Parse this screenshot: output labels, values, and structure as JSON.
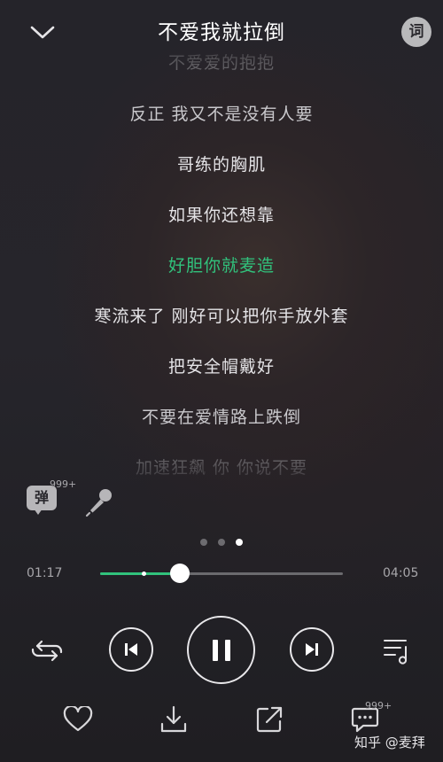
{
  "header": {
    "song_title": "不爱我就拉倒",
    "lyric_button_label": "词"
  },
  "lyrics": [
    "不爱爱的抱抱",
    "反正 我又不是没有人要",
    "哥练的胸肌",
    "如果你还想靠",
    "好胆你就麦造",
    "寒流来了 刚好可以把你手放外套",
    "把安全帽戴好",
    "不要在爱情路上跌倒",
    "加速狂飙 你 你说不要"
  ],
  "active_lyric_index": 4,
  "danmaku": {
    "label": "弹",
    "count": "999+"
  },
  "icons": {
    "back": "chevron-down-icon",
    "mic": "microphone-icon",
    "loop": "repeat-icon",
    "prev": "skip-previous-icon",
    "play_pause": "pause-icon",
    "next": "skip-next-icon",
    "playlist": "playlist-icon",
    "like": "heart-icon",
    "download": "download-icon",
    "share": "share-icon",
    "comment": "comment-icon"
  },
  "pager": {
    "pages": 3,
    "active": 2
  },
  "progress": {
    "elapsed": "01:17",
    "total": "04:05",
    "played_fraction": 0.33,
    "marker_fraction": 0.18
  },
  "comments": {
    "count": "999+"
  },
  "colors": {
    "accent": "#31c27c",
    "text": "#ffffff"
  },
  "watermark": "知乎 @麦拜"
}
